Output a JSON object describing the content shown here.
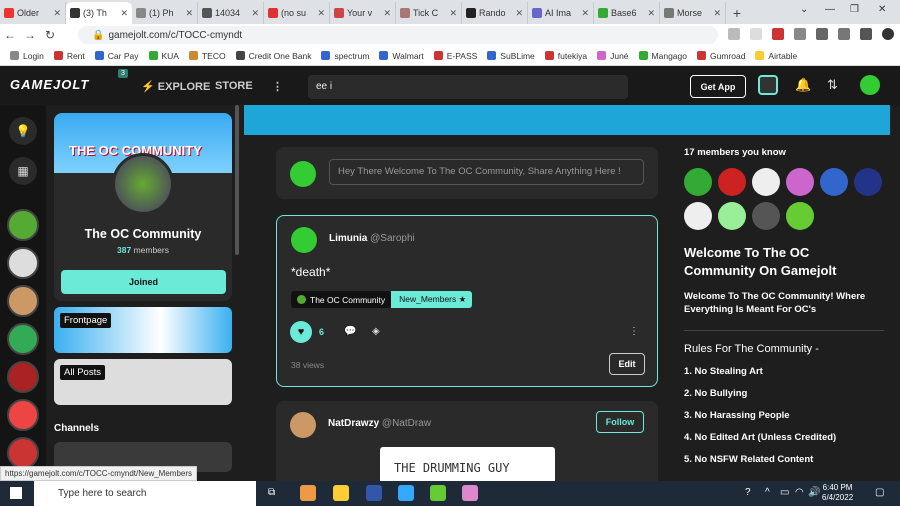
{
  "browser": {
    "tabs": [
      {
        "title": "Older",
        "color": "#e33"
      },
      {
        "title": "(3) Th",
        "color": "#333"
      },
      {
        "title": "(1) Ph",
        "color": "#888"
      },
      {
        "title": "14034",
        "color": "#555"
      },
      {
        "title": "(no su",
        "color": "#d33"
      },
      {
        "title": "Your v",
        "color": "#c44"
      },
      {
        "title": "Tick C",
        "color": "#a77"
      },
      {
        "title": "Rando",
        "color": "#222"
      },
      {
        "title": "AI Ima",
        "color": "#66c"
      },
      {
        "title": "Base6",
        "color": "#3a3"
      },
      {
        "title": "Morse",
        "color": "#777"
      }
    ],
    "url": "gamejolt.com/c/TOCC-cmyndt",
    "bookmarks": [
      {
        "label": "Login",
        "color": "#888"
      },
      {
        "label": "Rent",
        "color": "#c33"
      },
      {
        "label": "Car Pay",
        "color": "#36c"
      },
      {
        "label": "KUA",
        "color": "#3a3"
      },
      {
        "label": "TECO",
        "color": "#c83"
      },
      {
        "label": "Credit One Bank",
        "color": "#444"
      },
      {
        "label": "spectrum",
        "color": "#36c"
      },
      {
        "label": "Walmart",
        "color": "#36c"
      },
      {
        "label": "E-PASS",
        "color": "#c33"
      },
      {
        "label": "SuBLime",
        "color": "#36c"
      },
      {
        "label": "futekiya",
        "color": "#c33"
      },
      {
        "label": "Juné",
        "color": "#c6c"
      },
      {
        "label": "Mangago",
        "color": "#3a3"
      },
      {
        "label": "Gumroad",
        "color": "#c33"
      },
      {
        "label": "Airtable",
        "color": "#fc3"
      }
    ]
  },
  "header": {
    "logo": "GAMEJOLT",
    "logo_badge": "3",
    "explore": "EXPLORE",
    "store": "STORE",
    "search_value": "ee i",
    "get_app": "Get App"
  },
  "community": {
    "banner_text": "THE OC COMMUNITY",
    "name": "The OC Community",
    "members_count": "387",
    "members_label": "members",
    "joined": "Joined",
    "channels_heading": "Channels",
    "channels": [
      {
        "label": "Frontpage"
      },
      {
        "label": "All Posts"
      }
    ]
  },
  "composer": {
    "placeholder": "Hey There Welcome To The OC Community, Share Anything Here !"
  },
  "post": {
    "author": "Limunia",
    "handle": "@Sarophi",
    "text": "*death*",
    "tag_community": "The OC Community",
    "tag_channel": "New_Members",
    "likes": "6",
    "views": "38 views",
    "edit": "Edit"
  },
  "post2": {
    "author": "NatDrawzy",
    "handle": "@NatDraw",
    "follow": "Follow",
    "drawing_text": "THE DRUMMING GUY"
  },
  "sidebar_right": {
    "members_known": "17 members you know",
    "avatar_colors": [
      "#3a3",
      "#c22",
      "#eee",
      "#c6c",
      "#36c",
      "#238",
      "#eee",
      "#9e9",
      "#555",
      "#6c3"
    ],
    "title": "Welcome To The OC Community On Gamejolt",
    "description": "Welcome To The OC Community! Where Everything Is Meant For OC's",
    "rules_heading": "Rules For The Community -",
    "rules": [
      "1. No Stealing Art",
      "2. No Bullying",
      "3. No Harassing People",
      "4. No Edited Art (Unless Credited)",
      "5. No NSFW Related Content"
    ]
  },
  "status_url": "https://gamejolt.com/c/TOCC-cmyndt/New_Members",
  "taskbar": {
    "search_placeholder": "Type here to search",
    "time": "6:40 PM",
    "date": "6/4/2022"
  },
  "colors": {
    "accent": "#6bead8",
    "bg": "#191919",
    "card": "#2a2a2a"
  }
}
